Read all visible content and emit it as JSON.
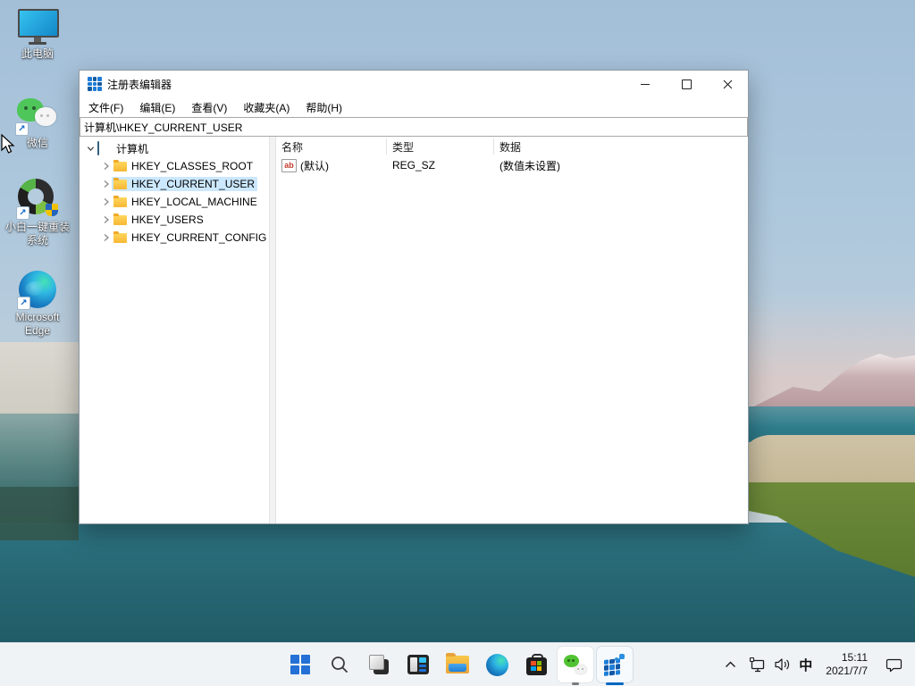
{
  "colors": {
    "accent": "#0a64c8",
    "tree_selection": "#cce8ff",
    "taskbar_background": "#eff3f6",
    "active_indicator": "#0067c0"
  },
  "desktop": {
    "icons": [
      {
        "name": "this-pc",
        "label1": "此电脑",
        "label2": ""
      },
      {
        "name": "wechat",
        "label1": "微信",
        "label2": ""
      },
      {
        "name": "xiaobai-reinstall",
        "label1": "小白一键重装",
        "label2": "系统"
      },
      {
        "name": "microsoft-edge",
        "label1": "Microsoft",
        "label2": "Edge"
      }
    ]
  },
  "window": {
    "title": "注册表编辑器",
    "menu": {
      "items": [
        {
          "label": "文件(F)"
        },
        {
          "label": "编辑(E)"
        },
        {
          "label": "查看(V)"
        },
        {
          "label": "收藏夹(A)"
        },
        {
          "label": "帮助(H)"
        }
      ]
    },
    "address": "计算机\\HKEY_CURRENT_USER",
    "tree": {
      "root": "计算机",
      "children": [
        {
          "label": "HKEY_CLASSES_ROOT",
          "selected": false
        },
        {
          "label": "HKEY_CURRENT_USER",
          "selected": true
        },
        {
          "label": "HKEY_LOCAL_MACHINE",
          "selected": false
        },
        {
          "label": "HKEY_USERS",
          "selected": false
        },
        {
          "label": "HKEY_CURRENT_CONFIG",
          "selected": false
        }
      ]
    },
    "list": {
      "columns": [
        {
          "label": "名称"
        },
        {
          "label": "类型"
        },
        {
          "label": "数据"
        }
      ],
      "rows": [
        {
          "name": "(默认)",
          "type": "REG_SZ",
          "data": "(数值未设置)",
          "icon": "string-value-icon"
        }
      ]
    }
  },
  "taskbar": {
    "buttons": [
      {
        "name": "start"
      },
      {
        "name": "search"
      },
      {
        "name": "overlapping-squares-app"
      },
      {
        "name": "task-view"
      },
      {
        "name": "file-explorer"
      },
      {
        "name": "edge"
      },
      {
        "name": "microsoft-store"
      },
      {
        "name": "wechat",
        "state": "running"
      },
      {
        "name": "registry-editor",
        "state": "active"
      }
    ]
  },
  "tray": {
    "ime": "中",
    "time": "15:11",
    "date": "2021/7/7"
  }
}
